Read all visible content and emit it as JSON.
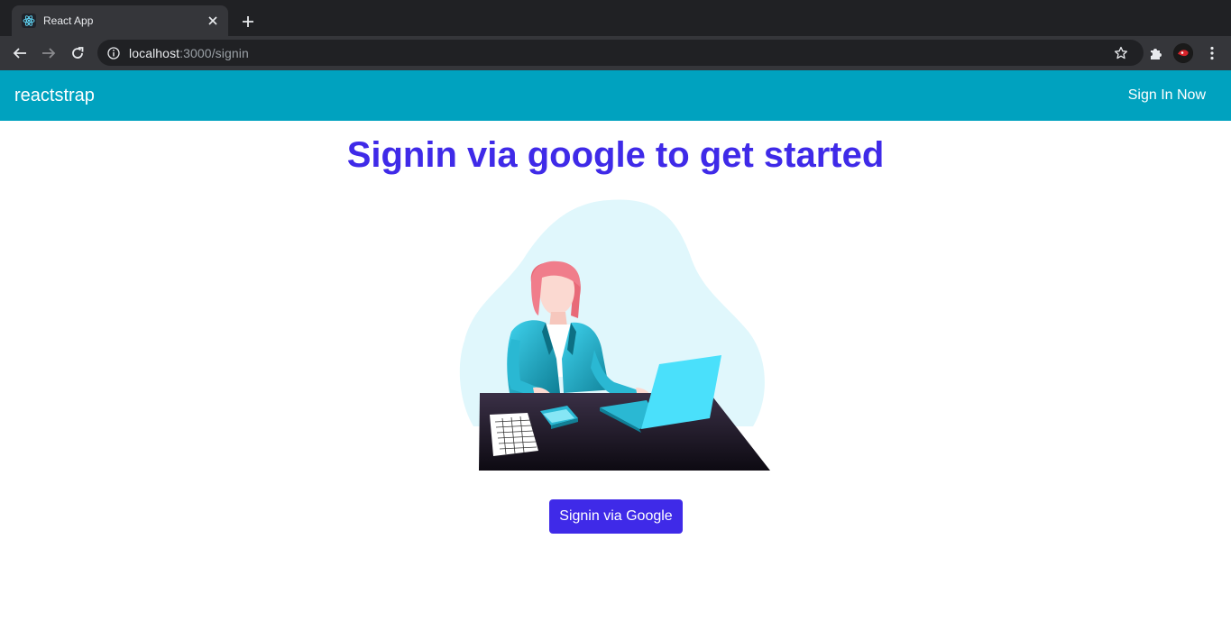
{
  "browser": {
    "tab_title": "React App",
    "url_host": "localhost",
    "url_path": ":3000/signin",
    "icons": [
      "react-logo-icon",
      "close-icon",
      "plus-icon",
      "back-arrow-icon",
      "forward-arrow-icon",
      "reload-icon",
      "info-icon",
      "star-icon",
      "puzzle-icon",
      "avatar-icon",
      "kebab-menu-icon"
    ]
  },
  "navbar": {
    "brand": "reactstrap",
    "link": "Sign In Now",
    "background": "#00a2bf"
  },
  "main": {
    "headline": "Signin via google to get started",
    "button_label": "Signin via Google",
    "accent": "#3f2ae8"
  }
}
